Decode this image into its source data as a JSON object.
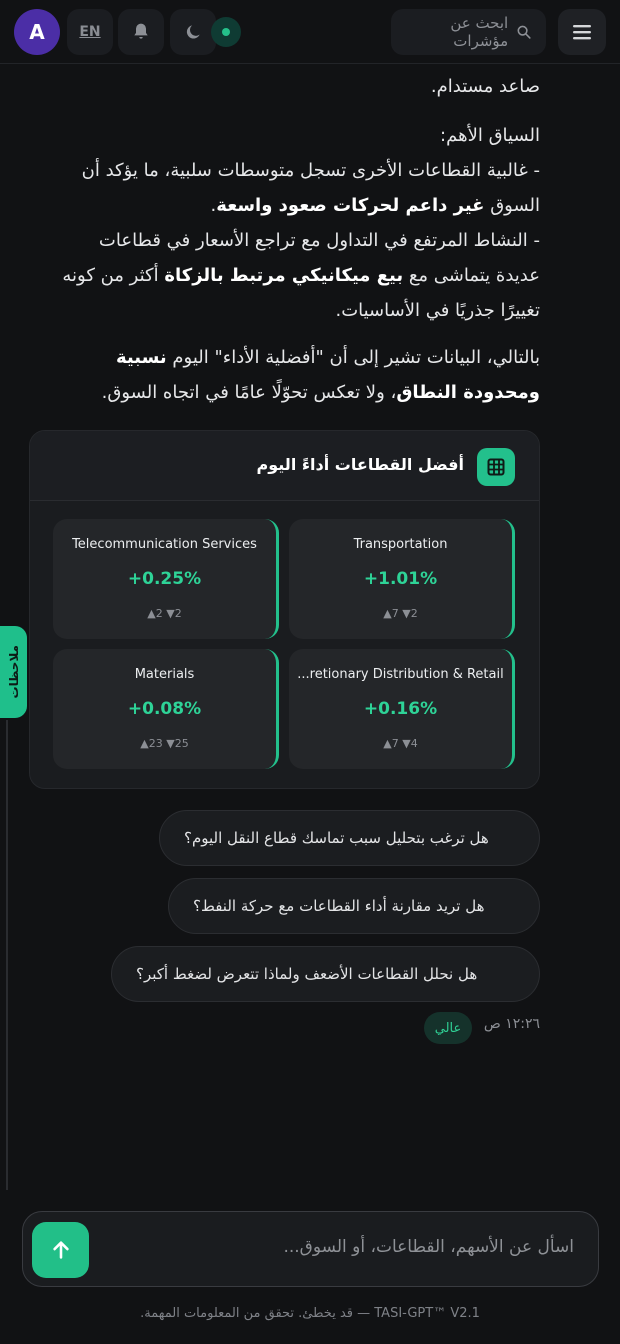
{
  "header": {
    "avatar_initial": "A",
    "lang_label": "EN",
    "search_placeholder": "ابحث عن مؤشرات",
    "icons": [
      "menu-icon",
      "search-icon",
      "bell-icon",
      "moon-icon"
    ]
  },
  "side_tab": {
    "label": "ملاحظات"
  },
  "message": {
    "line1": "صاعد مستدام.",
    "context_heading": "السياق الأهم:",
    "p1_a": "- غالبية القطاعات الأخرى تسجل متوسطات سلبية، ما يؤكد أن",
    "p1_b": "السوق ",
    "p1_bold": "غير داعم لحركات صعود واسعة",
    "p1_end": ".",
    "p2_a": "- النشاط المرتفع في التداول مع تراجع الأسعار في قطاعات",
    "p2_b": "عديدة يتماشى مع ",
    "p2_bold": "بيع ميكانيكي مرتبط بالزكاة",
    "p2_c": " أكثر من كونه",
    "p2_d": "تغييرًا جذريًا في الأساسيات.",
    "p3_a": "بالتالي، البيانات تشير إلى أن \"أفضلية الأداء\" اليوم ",
    "p3_bold1": "نسبية",
    "p3_bold2": "ومحدودة النطاق",
    "p3_c": "، ولا تعكس تحوّلًا عامًا في اتجاه السوق."
  },
  "sectors_card": {
    "title": "أفضل القطاعات أداءً اليوم",
    "tiles": [
      {
        "name": "Transportation",
        "change": "+1.01%",
        "counts": "▲7 ▼2"
      },
      {
        "name": "Telecommunication Services",
        "change": "+0.25%",
        "counts": "▲2 ▼2"
      },
      {
        "name": "...retionary Distribution & Retail",
        "change": "+0.16%",
        "counts": "▲7 ▼4"
      },
      {
        "name": "Materials",
        "change": "+0.08%",
        "counts": "▲23 ▼25"
      }
    ]
  },
  "suggestions": [
    "هل ترغب بتحليل سبب تماسك قطاع النقل اليوم؟",
    "هل تريد مقارنة أداء القطاعات مع حركة النفط؟",
    "هل نحلل القطاعات الأضعف ولماذا تتعرض لضغط أكبر؟"
  ],
  "meta": {
    "time": "١٢:٢٦ ص",
    "confidence_badge": "عالي"
  },
  "composer": {
    "placeholder": "اسأل عن الأسهم، القطاعات، أو السوق..."
  },
  "footer": {
    "text": "TASI-GPT™ V2.1 — قد يخطئ. تحقق من المعلومات المهمة."
  },
  "colors": {
    "accent": "#23c08c",
    "avatar": "#4b2ea6",
    "background": "#111214"
  }
}
